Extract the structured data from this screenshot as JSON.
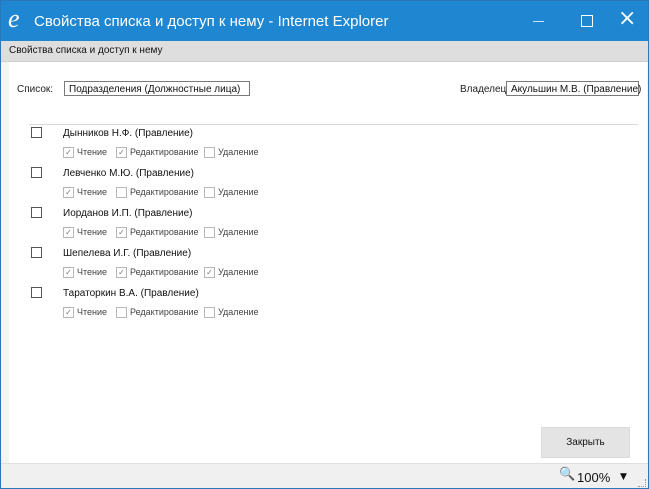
{
  "window": {
    "title": "Свойства списка и доступ к нему - Internet Explorer",
    "icon": "internet-explorer-icon",
    "icon_glyph": "e",
    "controls": {
      "minimize": "minimize-icon",
      "maximize": "maximize-icon",
      "close": "close-icon",
      "close_glyph": "×"
    },
    "accent_color": "#1f86d1"
  },
  "header": {
    "title": "Свойства списка и доступ к нему"
  },
  "form": {
    "list_label": "Список:",
    "list_value": "Подразделения (Должностные лица)",
    "owner_label": "Владелец:",
    "owner_value": "Акульшин М.В. (Правление)"
  },
  "permission_labels": {
    "read": "Чтение",
    "edit": "Редактирование",
    "delete": "Удаление"
  },
  "users": [
    {
      "name": "Дынников Н.Ф. (Правление)",
      "selected": false,
      "read": true,
      "edit": true,
      "delete": false
    },
    {
      "name": "Левченко М.Ю. (Правление)",
      "selected": false,
      "read": true,
      "edit": false,
      "delete": false
    },
    {
      "name": "Иорданов И.П. (Правление)",
      "selected": false,
      "read": true,
      "edit": true,
      "delete": false
    },
    {
      "name": "Шепелева И.Г. (Правление)",
      "selected": false,
      "read": true,
      "edit": true,
      "delete": true
    },
    {
      "name": "Тараторкин В.А. (Правление)",
      "selected": false,
      "read": true,
      "edit": false,
      "delete": false
    }
  ],
  "check_glyph": "✓",
  "buttons": {
    "close": "Закрыть"
  },
  "status": {
    "zoom": "100%",
    "zoom_icon": "zoom-icon",
    "zoom_glyph": "🔍",
    "dropdown_glyph": "▼"
  }
}
